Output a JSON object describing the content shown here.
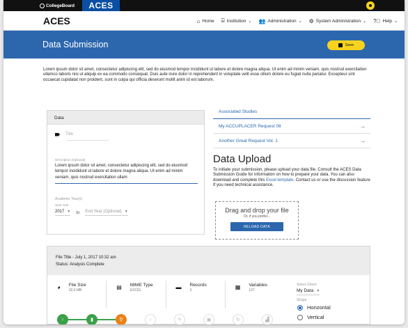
{
  "topbar": {
    "brand": "CollegeBoard",
    "app_tab": "ACES"
  },
  "nav": {
    "title": "ACES",
    "items": [
      {
        "label": "Home",
        "icon": "home-icon"
      },
      {
        "label": "Institution",
        "icon": "institution-icon"
      },
      {
        "label": "Administration",
        "icon": "people-icon"
      },
      {
        "label": "System Administration",
        "icon": "gear-icon"
      },
      {
        "label": "Help",
        "icon": "help-icon"
      }
    ]
  },
  "header": {
    "title": "Data Submission",
    "save_label": "Save"
  },
  "intro": "Lorem ipsum dolor sit amet, consectetur adipiscing elit, sed do eiusmod tempor incididunt ut labore et dolore magna aliqua. Ut enim ad minim veniam, quis nostrud exercitation ullamco laboris nisi ut aliquip ex ea commodo consequat. Duis aute irure dolor in reprehenderit in voluptate velit esse cillum dolore eu fugiat nulla pariatur. Excepteur sint occaecat cupidatat non proident, sunt in culpa qui officia deserunt mollit anim id est laborum.",
  "data_card": {
    "header": "Data",
    "title_placeholder": "Title",
    "description_label": "Description (Optional)",
    "description_value": "Lorem ipsum dolor sit amet, consectetur adipiscing elit, sed do eiusmod tempor incididunt ut labore et dolore magna aliqua. Ut enim ad minim veniam, quis nostrud exercitation ullam",
    "academic_year_label": "Academic Year(s)",
    "start_year_label": "Start Year",
    "start_year_value": "2017",
    "to_label": "to",
    "end_year_placeholder": "End Year (Optional)"
  },
  "associated": {
    "header": "Associated Studies",
    "items": [
      "My ACCUPLACER Request 08",
      "Another Great Request Vol. 1"
    ]
  },
  "upload": {
    "title": "Data Upload",
    "text_before_link": "To initiate your submission, please upload your data file. Consult the ACES Data Submission Guide for information on how to prepare your data. You can also download and complete this ",
    "link": "Excel template",
    "text_after_link": ". Contact us or use the discussion feature If you need technical assistance.",
    "drop_title": "Drag and drop your file",
    "drop_sub": "Or, if you prefer...",
    "reload_label": "RELOAD DATA"
  },
  "file": {
    "title": "File Title - July 1, 2017 10:32 am",
    "status": "Status: Analysis Complete",
    "stats": [
      {
        "label": "File Size",
        "value": "32.6 MB",
        "icon": "pie-chart-icon"
      },
      {
        "label": "MIME Type",
        "value": "EXCEL",
        "icon": "document-icon"
      },
      {
        "label": "Records",
        "value": "3",
        "icon": "folder-icon"
      },
      {
        "label": "Variables",
        "value": "137",
        "icon": "grid-icon"
      }
    ],
    "sheet_label": "Select Sheet",
    "sheet_value": "My Data",
    "shape_label": "Shape",
    "shape_options": [
      "Horizontal",
      "Vertical"
    ],
    "shape_selected": "Horizontal"
  }
}
